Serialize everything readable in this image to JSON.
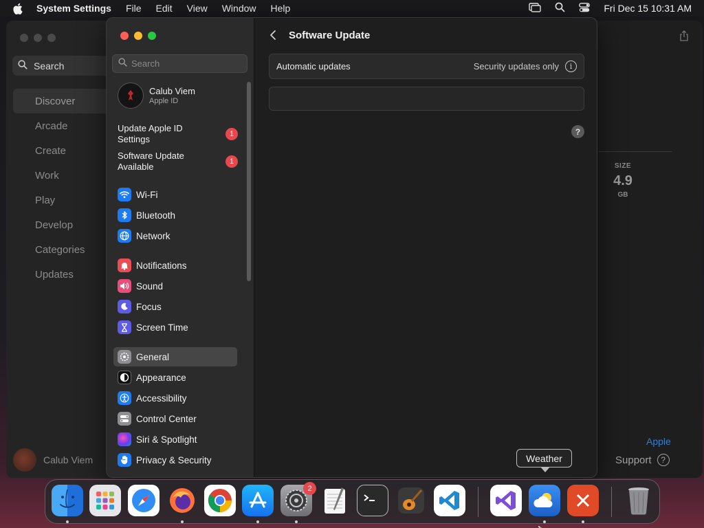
{
  "menubar": {
    "app_name": "System Settings",
    "menus": [
      "File",
      "Edit",
      "View",
      "Window",
      "Help"
    ],
    "clock": "Fri Dec 15  10:31 AM"
  },
  "background_app": {
    "search_label": "Search",
    "nav": [
      "Discover",
      "Arcade",
      "Create",
      "Work",
      "Play",
      "Develop",
      "Categories",
      "Updates"
    ],
    "active_nav": "Discover",
    "user_name": "Calub Viem",
    "size_label": "SIZE",
    "size_value": "4.9",
    "size_unit": "GB",
    "developer_link": "Apple",
    "support_label": "Support"
  },
  "settings": {
    "search_placeholder": "Search",
    "account": {
      "name": "Calub Viem",
      "subtitle": "Apple ID"
    },
    "notices": [
      {
        "label": "Update Apple ID Settings",
        "badge": "1"
      },
      {
        "label": "Software Update Available",
        "badge": "1"
      }
    ],
    "items": {
      "wifi": "Wi-Fi",
      "bluetooth": "Bluetooth",
      "network": "Network",
      "notifications": "Notifications",
      "sound": "Sound",
      "focus": "Focus",
      "screen_time": "Screen Time",
      "general": "General",
      "appearance": "Appearance",
      "accessibility": "Accessibility",
      "control_center": "Control Center",
      "siri": "Siri & Spotlight",
      "privacy": "Privacy & Security"
    },
    "active_item": "General",
    "page_title": "Software Update",
    "auto_updates_label": "Automatic updates",
    "auto_updates_value": "Security updates only"
  },
  "tooltip": "Weather",
  "dock": {
    "apps": [
      "Finder",
      "Launchpad",
      "Safari",
      "Firefox",
      "Chrome",
      "App Store",
      "System Settings",
      "TextEdit",
      "Terminal",
      "GarageBand",
      "Visual Studio Code",
      "Visual Studio",
      "Weather",
      "Remote Desktop",
      "Trash"
    ],
    "settings_badge": "2"
  },
  "colors": {
    "accent": "#2f7fd6",
    "badge": "#e5484d",
    "close": "#ff5f57",
    "minimize": "#febc2e",
    "zoom": "#28c840"
  }
}
